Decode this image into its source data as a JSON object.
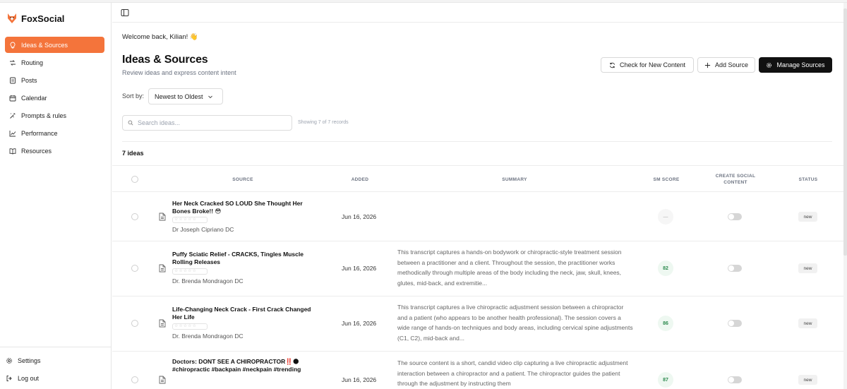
{
  "app": {
    "name": "FoxSocial",
    "accent": "#f4743b"
  },
  "sidebar": {
    "items": [
      {
        "label": "Ideas & Sources",
        "icon": "lightbulb-icon",
        "active": true
      },
      {
        "label": "Routing",
        "icon": "routing-icon",
        "active": false
      },
      {
        "label": "Posts",
        "icon": "document-icon",
        "active": false
      },
      {
        "label": "Calendar",
        "icon": "calendar-icon",
        "active": false
      },
      {
        "label": "Prompts & rules",
        "icon": "wand-icon",
        "active": false
      },
      {
        "label": "Performance",
        "icon": "chart-icon",
        "active": false
      },
      {
        "label": "Resources",
        "icon": "book-icon",
        "active": false
      }
    ],
    "bottom": [
      {
        "label": "Settings",
        "icon": "gear-icon"
      },
      {
        "label": "Log out",
        "icon": "logout-icon"
      }
    ]
  },
  "header": {
    "welcome": "Welcome back, Kilian! 👋",
    "title": "Ideas & Sources",
    "subtitle": "Review ideas and express content intent",
    "buttons": {
      "check": "Check for New Content",
      "add": "Add Source",
      "manage": "Manage Sources"
    }
  },
  "filters": {
    "sort_label": "Sort by:",
    "sort_value": "Newest to Oldest",
    "search_placeholder": "Search ideas...",
    "showing": "Showing 7 of 7 records"
  },
  "list": {
    "count_label": "7 ideas",
    "columns": {
      "source": "SOURCE",
      "added": "ADDED",
      "summary": "SUMMARY",
      "score": "SM SCORE",
      "create": "CREATE SOCIAL CONTENT",
      "status": "STATUS"
    },
    "rows": [
      {
        "title": "Her Neck Cracked SO LOUD She Thought Her Bones Broke!! 😳",
        "author": "Dr Joseph Cipriano DC",
        "added": "Jun 16, 2026",
        "summary": "",
        "score": "—",
        "status": "new"
      },
      {
        "title": "Puffy Sciatic Relief - CRACKS, Tingles Muscle Rolling Releases",
        "author": "Dr. Brenda Mondragon DC",
        "added": "Jun 16, 2026",
        "summary": "This transcript captures a hands-on bodywork or chiropractic-style treatment session between a practitioner and a client. Throughout the session, the practitioner works methodically through multiple areas of the body including the neck, jaw, skull, knees, glutes, mid-back, and extremitie...",
        "score": "82",
        "status": "new"
      },
      {
        "title": "Life-Changing Neck Crack - First Crack Changed Her Life",
        "author": "Dr. Brenda Mondragon DC",
        "added": "Jun 16, 2026",
        "summary": "This transcript captures a live chiropractic adjustment session between a chiropractor and a patient (who appears to be another health professional). The session covers a wide range of hands-on techniques and body areas, including cervical spine adjustments (C1, C2), mid-back and...",
        "score": "86",
        "status": "new"
      },
      {
        "title": "Doctors: DONT SEE A CHIROPRACTOR‼️🌑 #chiropractic #backpain #neckpain #trending",
        "author": "",
        "added": "Jun 16, 2026",
        "summary": "The source content is a short, candid video clip capturing a live chiropractic adjustment interaction between a chiropractor and a patient. The chiropractor guides the patient through the adjustment by instructing them",
        "score": "87",
        "status": "new"
      }
    ]
  }
}
